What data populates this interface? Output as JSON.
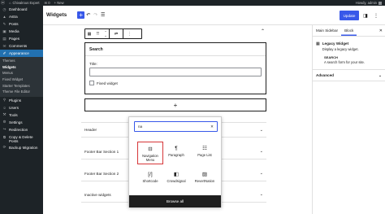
{
  "admin_bar": {
    "site_name": "Chivalrous Expert",
    "comments_count": "0",
    "new_label": "+ New",
    "howdy": "Howdy, admin"
  },
  "admin_menu": {
    "items": [
      {
        "label": "Dashboard",
        "icon": "dashboard-icon",
        "glyph": "◷"
      },
      {
        "label": "Astra",
        "icon": "astra-icon",
        "glyph": "▲"
      },
      {
        "label": "Posts",
        "icon": "posts-icon",
        "glyph": "✎"
      },
      {
        "label": "Media",
        "icon": "media-icon",
        "glyph": "▣"
      },
      {
        "label": "Pages",
        "icon": "pages-icon",
        "glyph": "▤"
      },
      {
        "label": "Comments",
        "icon": "comments-icon",
        "glyph": "✉"
      },
      {
        "label": "Appearance",
        "icon": "appearance-icon",
        "glyph": "✐"
      }
    ],
    "submenu": [
      "Themes",
      "Widgets",
      "Menus",
      "Fixed Widget",
      "Starter Templates",
      "Theme File Editor"
    ],
    "items_after": [
      {
        "label": "Plugins",
        "icon": "plugins-icon",
        "glyph": "⚲"
      },
      {
        "label": "Users",
        "icon": "users-icon",
        "glyph": "☺"
      },
      {
        "label": "Tools",
        "icon": "tools-icon",
        "glyph": "⚒"
      },
      {
        "label": "Settings",
        "icon": "settings-icon",
        "glyph": "⚙"
      },
      {
        "label": "Redirection",
        "icon": "redirection-icon",
        "glyph": "↪"
      },
      {
        "label": "Copy & Delete Posts",
        "icon": "copy-delete-icon",
        "glyph": "⧉"
      },
      {
        "label": "Backup Migration",
        "icon": "backup-icon",
        "glyph": "⟳"
      }
    ]
  },
  "header": {
    "title": "Widgets",
    "update_label": "Update"
  },
  "legacy_widget": {
    "title": "Search",
    "field_label": "Title:",
    "checkbox_label": "Fixed widget"
  },
  "areas": [
    "Header",
    "Footer Bar Section 1",
    "Footer Bar Section 2",
    "Inactive widgets"
  ],
  "inserter": {
    "search_value": "na",
    "items": [
      {
        "label": "Navigation Menu",
        "icon": "navigation-icon",
        "glyph": "⊟"
      },
      {
        "label": "Paragraph",
        "icon": "paragraph-icon",
        "glyph": "¶"
      },
      {
        "label": "Page List",
        "icon": "page-list-icon",
        "glyph": "☷"
      },
      {
        "label": "Shortcode",
        "icon": "shortcode-icon",
        "glyph": "[/]"
      },
      {
        "label": "Crowdsignal",
        "icon": "crowdsignal-icon",
        "glyph": "◧"
      },
      {
        "label": "RevertNation",
        "icon": "revertnation-icon",
        "glyph": "▨"
      }
    ],
    "browse_all": "Browse all"
  },
  "settings": {
    "tabs": [
      "Main Sidebar",
      "Block"
    ],
    "block_name": "Legacy Widget",
    "block_desc": "Display a legacy widget.",
    "widget_head": "SEARCH",
    "widget_desc": "A search form for your site.",
    "advanced": "Advanced"
  },
  "colors": {
    "accent": "#3858e9",
    "wp_blue": "#2271b1",
    "highlight": "#d63638"
  }
}
